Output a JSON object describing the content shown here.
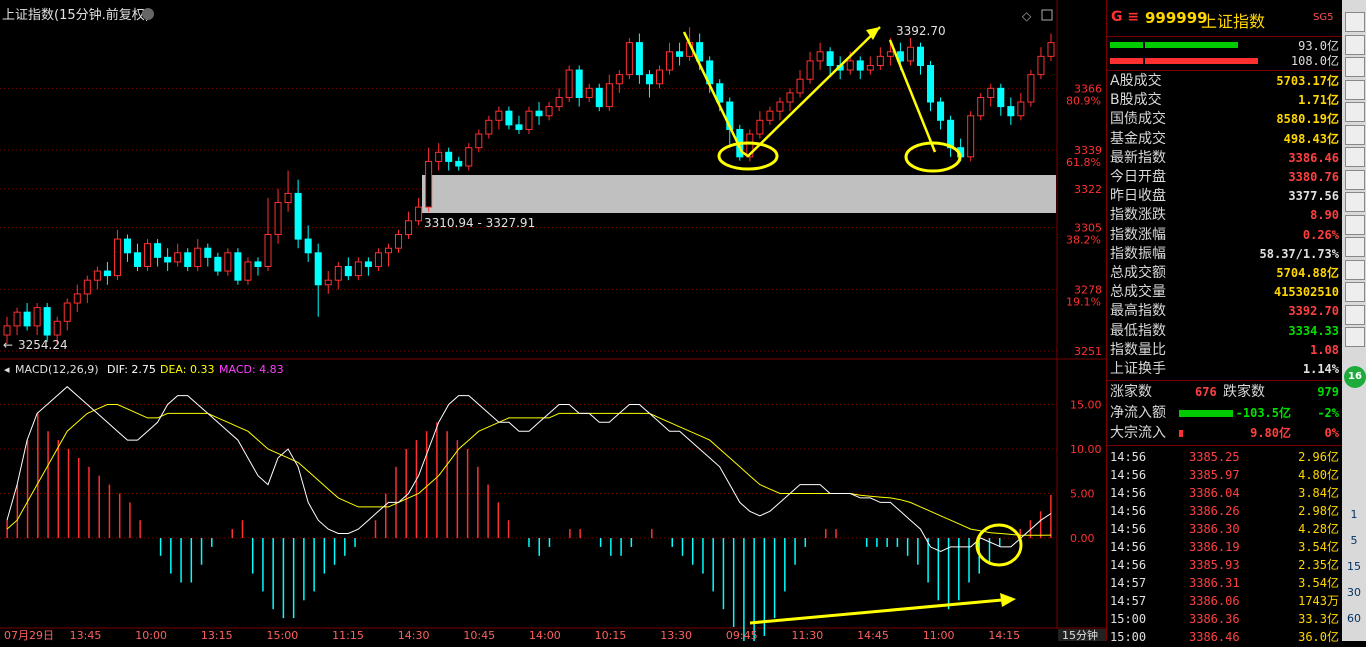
{
  "chart_title": "上证指数(15分钟.前复权)",
  "chart_data": [
    {
      "type": "candlestick",
      "price_ticks": [
        "3366",
        "3339",
        "3322",
        "3305",
        "3278",
        "3251"
      ],
      "pct_ticks": [
        "80.9%",
        "61.8%",
        "38.2%",
        "19.1%"
      ],
      "annotations": {
        "high_label": "3392.70",
        "low_label": "3254.24",
        "zone_label": "3310.94 - 3327.91"
      },
      "candles": [
        [
          3258,
          3262,
          3254.24,
          3266
        ],
        [
          3262,
          3268,
          3258,
          3270
        ],
        [
          3268,
          3262,
          3260,
          3272
        ],
        [
          3262,
          3270,
          3258,
          3272
        ],
        [
          3270,
          3258,
          3255,
          3272
        ],
        [
          3258,
          3264,
          3254,
          3266
        ],
        [
          3264,
          3272,
          3260,
          3274
        ],
        [
          3272,
          3276,
          3268,
          3280
        ],
        [
          3276,
          3282,
          3272,
          3284
        ],
        [
          3282,
          3286,
          3278,
          3288
        ],
        [
          3286,
          3284,
          3280,
          3290
        ],
        [
          3284,
          3300,
          3282,
          3304
        ],
        [
          3300,
          3294,
          3290,
          3302
        ],
        [
          3294,
          3288,
          3286,
          3298
        ],
        [
          3288,
          3298,
          3286,
          3300
        ],
        [
          3298,
          3292,
          3288,
          3300
        ],
        [
          3292,
          3290,
          3286,
          3296
        ],
        [
          3290,
          3294,
          3288,
          3298
        ],
        [
          3294,
          3288,
          3286,
          3296
        ],
        [
          3288,
          3296,
          3286,
          3300
        ],
        [
          3296,
          3292,
          3288,
          3298
        ],
        [
          3292,
          3286,
          3284,
          3294
        ],
        [
          3286,
          3294,
          3284,
          3296
        ],
        [
          3294,
          3282,
          3280,
          3296
        ],
        [
          3282,
          3290,
          3280,
          3292
        ],
        [
          3290,
          3288,
          3284,
          3292
        ],
        [
          3288,
          3302,
          3286,
          3318
        ],
        [
          3302,
          3316,
          3298,
          3322
        ],
        [
          3316,
          3320,
          3312,
          3330
        ],
        [
          3320,
          3300,
          3296,
          3326
        ],
        [
          3300,
          3294,
          3290,
          3306
        ],
        [
          3294,
          3280,
          3266,
          3298
        ],
        [
          3280,
          3282,
          3276,
          3286
        ],
        [
          3282,
          3288,
          3278,
          3290
        ],
        [
          3288,
          3284,
          3282,
          3292
        ],
        [
          3284,
          3290,
          3282,
          3292
        ],
        [
          3290,
          3288,
          3284,
          3292
        ],
        [
          3288,
          3294,
          3286,
          3296
        ],
        [
          3294,
          3296,
          3288,
          3298
        ],
        [
          3296,
          3302,
          3294,
          3304
        ],
        [
          3302,
          3308,
          3300,
          3312
        ],
        [
          3308,
          3314,
          3306,
          3318
        ],
        [
          3314,
          3334,
          3312,
          3340
        ],
        [
          3334,
          3338,
          3330,
          3342
        ],
        [
          3338,
          3334,
          3330,
          3340
        ],
        [
          3334,
          3332,
          3330,
          3336
        ],
        [
          3332,
          3340,
          3330,
          3342
        ],
        [
          3340,
          3346,
          3338,
          3348
        ],
        [
          3346,
          3352,
          3344,
          3354
        ],
        [
          3352,
          3356,
          3348,
          3358
        ],
        [
          3356,
          3350,
          3348,
          3358
        ],
        [
          3350,
          3348,
          3346,
          3354
        ],
        [
          3348,
          3356,
          3346,
          3358
        ],
        [
          3356,
          3354,
          3350,
          3360
        ],
        [
          3354,
          3358,
          3352,
          3360
        ],
        [
          3358,
          3362,
          3356,
          3366
        ],
        [
          3362,
          3374,
          3360,
          3376
        ],
        [
          3374,
          3362,
          3358,
          3376
        ],
        [
          3362,
          3366,
          3360,
          3368
        ],
        [
          3366,
          3358,
          3356,
          3368
        ],
        [
          3358,
          3368,
          3356,
          3372
        ],
        [
          3368,
          3372,
          3364,
          3374
        ],
        [
          3372,
          3386,
          3370,
          3388
        ],
        [
          3386,
          3372,
          3368,
          3390
        ],
        [
          3372,
          3368,
          3362,
          3374
        ],
        [
          3368,
          3374,
          3366,
          3376
        ],
        [
          3374,
          3382,
          3372,
          3386
        ],
        [
          3382,
          3380,
          3376,
          3386
        ],
        [
          3380,
          3386,
          3378,
          3392.7
        ],
        [
          3386,
          3378,
          3374,
          3390
        ],
        [
          3378,
          3368,
          3364,
          3380
        ],
        [
          3368,
          3360,
          3356,
          3370
        ],
        [
          3360,
          3348,
          3340,
          3362
        ],
        [
          3348,
          3336,
          3334.33,
          3350
        ],
        [
          3336,
          3346,
          3334,
          3348
        ],
        [
          3346,
          3352,
          3344,
          3356
        ],
        [
          3352,
          3356,
          3350,
          3358
        ],
        [
          3356,
          3360,
          3352,
          3362
        ],
        [
          3360,
          3364,
          3356,
          3366
        ],
        [
          3364,
          3370,
          3362,
          3374
        ],
        [
          3370,
          3378,
          3368,
          3382
        ],
        [
          3378,
          3382,
          3374,
          3386
        ],
        [
          3382,
          3376,
          3372,
          3384
        ],
        [
          3376,
          3374,
          3370,
          3380
        ],
        [
          3374,
          3378,
          3372,
          3382
        ],
        [
          3378,
          3374,
          3370,
          3380
        ],
        [
          3374,
          3376,
          3372,
          3380
        ],
        [
          3376,
          3380,
          3374,
          3384
        ],
        [
          3380,
          3382,
          3376,
          3388
        ],
        [
          3382,
          3378,
          3374,
          3386
        ],
        [
          3378,
          3384,
          3376,
          3388
        ],
        [
          3384,
          3376,
          3372,
          3386
        ],
        [
          3376,
          3360,
          3356,
          3378
        ],
        [
          3360,
          3352,
          3348,
          3362
        ],
        [
          3352,
          3340,
          3336,
          3354
        ],
        [
          3340,
          3336,
          3334,
          3344
        ],
        [
          3336,
          3354,
          3334,
          3356
        ],
        [
          3354,
          3362,
          3352,
          3364
        ],
        [
          3362,
          3366,
          3358,
          3368
        ],
        [
          3366,
          3358,
          3354,
          3368
        ],
        [
          3358,
          3354,
          3350,
          3362
        ],
        [
          3354,
          3360,
          3352,
          3364
        ],
        [
          3360,
          3372,
          3358,
          3374
        ],
        [
          3372,
          3380,
          3370,
          3384
        ],
        [
          3380,
          3386,
          3378,
          3390
        ]
      ]
    },
    {
      "type": "macd",
      "legend": {
        "name": "MACD(12,26,9)",
        "dif": "DIF: 2.75",
        "dea": "DEA: 0.33",
        "macd": "MACD: 4.83"
      },
      "y_ticks": [
        "15.00",
        "10.00",
        "5.00",
        "0.00"
      ],
      "ylim": [
        -10,
        18
      ],
      "dif": [
        2,
        6,
        11,
        14,
        15,
        16,
        17,
        16,
        15,
        14,
        13,
        12,
        11,
        11,
        12,
        13,
        15,
        16,
        16,
        15,
        14,
        13,
        12,
        11,
        9,
        7,
        6,
        9,
        10,
        8,
        4,
        2,
        1,
        0.5,
        0.5,
        1,
        2,
        3,
        4,
        4,
        5,
        7,
        10,
        13,
        15,
        16,
        16,
        15,
        14,
        13,
        13,
        12,
        12,
        13,
        14,
        15,
        15,
        14,
        14,
        13,
        13,
        14,
        15,
        15,
        14,
        13,
        12,
        12,
        11,
        10,
        9,
        8,
        6,
        4,
        3,
        2.5,
        3,
        4,
        5,
        6,
        6,
        6,
        5,
        5,
        5,
        4.5,
        4.5,
        4,
        4,
        3,
        2,
        1,
        -1,
        -1.5,
        -1,
        -1,
        -1,
        0,
        -0.5,
        -1,
        -1,
        0,
        1,
        2,
        2.75
      ],
      "dea": [
        1,
        2,
        4,
        6,
        8,
        10,
        12,
        13,
        14,
        14.5,
        15,
        15,
        14.5,
        14,
        13.5,
        13.5,
        14,
        14,
        14,
        14,
        14,
        13.5,
        13,
        12.5,
        12,
        11,
        10,
        9.5,
        9,
        8.5,
        7.5,
        6.5,
        5.5,
        4.5,
        4,
        3.5,
        3.5,
        3.5,
        3.5,
        4,
        4.5,
        5,
        6,
        7,
        8.5,
        10,
        11,
        12,
        12.5,
        13,
        13.5,
        13.5,
        13.5,
        13.5,
        13.5,
        14,
        14,
        14,
        14,
        14,
        14,
        14,
        14,
        14,
        14,
        13.5,
        13,
        12.5,
        12,
        11.5,
        11,
        10,
        9,
        8,
        7,
        6,
        5.5,
        5,
        5,
        5,
        5,
        5,
        5,
        5,
        5,
        4.8,
        4.7,
        4.6,
        4.5,
        4.3,
        4,
        3.5,
        3,
        2.5,
        2,
        1.5,
        1,
        0.8,
        0.6,
        0.5,
        0.4,
        0.3,
        0.3,
        0.3,
        0.33
      ],
      "macd": [
        2,
        6,
        11,
        14,
        12,
        11,
        10,
        9,
        8,
        7,
        6,
        5,
        4,
        2,
        0,
        -2,
        -4,
        -5,
        -5,
        -3,
        -1,
        0,
        1,
        2,
        -4,
        -6,
        -8,
        -9,
        -9,
        -7,
        -6,
        -4,
        -3,
        -2,
        -1,
        0,
        2,
        5,
        8,
        10,
        11,
        12,
        13,
        12,
        11,
        10,
        8,
        6,
        4,
        2,
        0,
        -1,
        -2,
        -1,
        0,
        1,
        1,
        0,
        -1,
        -2,
        -2,
        -1,
        0,
        1,
        0,
        -1,
        -2,
        -3,
        -4,
        -6,
        -8,
        -10,
        -12,
        -12,
        -11,
        -9,
        -6,
        -3,
        -1,
        0,
        1,
        1,
        0,
        0,
        -1,
        -1,
        -1,
        -1,
        -2,
        -3,
        -5,
        -7,
        -8,
        -7,
        -5,
        -4,
        -3,
        -1,
        0,
        1,
        2,
        3,
        4.83
      ]
    }
  ],
  "time_axis": [
    "07月29日",
    "13:45",
    "10:00",
    "13:15",
    "15:00",
    "11:15",
    "14:30",
    "10:45",
    "14:00",
    "10:15",
    "13:30",
    "09:45",
    "11:30",
    "14:45",
    "11:00",
    "14:15"
  ],
  "period_tab": "15分钟",
  "panel": {
    "code_prefix": "G ≡",
    "code": "999999",
    "name": "上证指数",
    "badge": "SG5",
    "bars": [
      {
        "value": "93.0亿",
        "color": "#00cc00"
      },
      {
        "value": "108.0亿",
        "color": "#ff3030"
      }
    ],
    "stats": [
      {
        "label": "A股成交",
        "value": "5703.17亿",
        "color": "#ffd700"
      },
      {
        "label": "B股成交",
        "value": "1.71亿",
        "color": "#ffd700"
      },
      {
        "label": "国债成交",
        "value": "8580.19亿",
        "color": "#ffd700"
      },
      {
        "label": "基金成交",
        "value": "498.43亿",
        "color": "#ffd700"
      },
      {
        "label": "最新指数",
        "value": "3386.46",
        "color": "#ff4040"
      },
      {
        "label": "今日开盘",
        "value": "3380.76",
        "color": "#ff4040"
      },
      {
        "label": "昨日收盘",
        "value": "3377.56",
        "color": "#e0e0e0"
      },
      {
        "label": "指数涨跌",
        "value": "8.90",
        "color": "#ff4040"
      },
      {
        "label": "指数涨幅",
        "value": "0.26%",
        "color": "#ff4040"
      },
      {
        "label": "指数振幅",
        "value": "58.37/1.73%",
        "color": "#e0e0e0"
      },
      {
        "label": "总成交额",
        "value": "5704.88亿",
        "color": "#ffd700"
      },
      {
        "label": "总成交量",
        "value": "415302510",
        "color": "#ffd700"
      },
      {
        "label": "最高指数",
        "value": "3392.70",
        "color": "#ff4040"
      },
      {
        "label": "最低指数",
        "value": "3334.33",
        "color": "#00e000"
      },
      {
        "label": "指数量比",
        "value": "1.08",
        "color": "#ff4040"
      },
      {
        "label": "上证换手",
        "value": "1.14%",
        "color": "#e0e0e0"
      }
    ],
    "up_label": "涨家数",
    "up_value": "676",
    "down_label": "跌家数",
    "down_value": "979",
    "flows": [
      {
        "label": "净流入额",
        "value": "-103.5亿",
        "pct": "-2%",
        "bar": "#00cc00",
        "color": "#00e000"
      },
      {
        "label": "大宗流入",
        "value": "9.80亿",
        "pct": "0%",
        "bar": "#ff3030",
        "color": "#ff4040"
      }
    ],
    "ticks": [
      {
        "t": "14:56",
        "p": "3385.25",
        "v": "2.96亿"
      },
      {
        "t": "14:56",
        "p": "3385.97",
        "v": "4.80亿"
      },
      {
        "t": "14:56",
        "p": "3386.04",
        "v": "3.84亿"
      },
      {
        "t": "14:56",
        "p": "3386.26",
        "v": "2.98亿"
      },
      {
        "t": "14:56",
        "p": "3386.30",
        "v": "4.28亿"
      },
      {
        "t": "14:56",
        "p": "3386.19",
        "v": "3.54亿"
      },
      {
        "t": "14:56",
        "p": "3385.93",
        "v": "2.35亿"
      },
      {
        "t": "14:57",
        "p": "3386.31",
        "v": "3.54亿"
      },
      {
        "t": "14:57",
        "p": "3386.06",
        "v": "1743万"
      },
      {
        "t": "15:00",
        "p": "3386.36",
        "v": "33.3亿"
      },
      {
        "t": "15:00",
        "p": "3386.46",
        "v": "36.0亿"
      }
    ]
  },
  "toolbar": {
    "circle_label": "16",
    "numbers": [
      "1",
      "5",
      "15",
      "30",
      "60"
    ]
  },
  "colors": {
    "up": "#ff3030",
    "down": "#00ffff",
    "dif": "#ffffff",
    "dea": "#ffff00",
    "grid": "#7a0000",
    "zone": "#c0c0c0",
    "arrow": "#ffff00"
  }
}
